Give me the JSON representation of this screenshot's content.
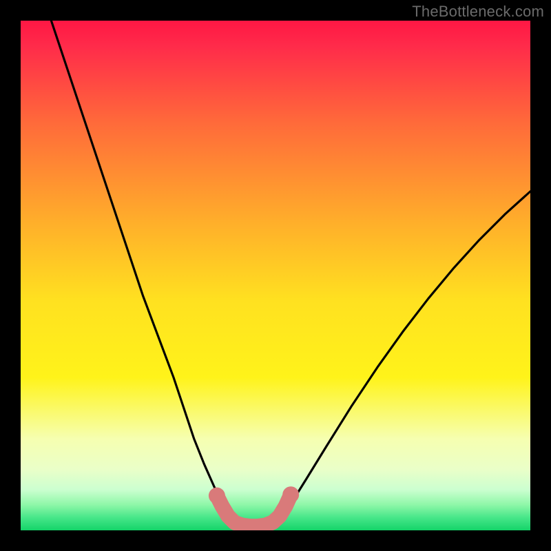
{
  "watermark": "TheBottleneck.com",
  "chart_data": {
    "type": "line",
    "title": "",
    "xlabel": "",
    "ylabel": "",
    "xlim": [
      0,
      1
    ],
    "ylim": [
      0,
      1
    ],
    "gradient_stops": [
      {
        "offset": 0.0,
        "color": "#ff1744"
      },
      {
        "offset": 0.05,
        "color": "#ff2b4a"
      },
      {
        "offset": 0.2,
        "color": "#ff6a3a"
      },
      {
        "offset": 0.4,
        "color": "#ffb02a"
      },
      {
        "offset": 0.55,
        "color": "#ffe120"
      },
      {
        "offset": 0.7,
        "color": "#fff31a"
      },
      {
        "offset": 0.82,
        "color": "#f6ffb0"
      },
      {
        "offset": 0.88,
        "color": "#eaffc8"
      },
      {
        "offset": 0.92,
        "color": "#ccffd0"
      },
      {
        "offset": 0.95,
        "color": "#8ef7a8"
      },
      {
        "offset": 0.975,
        "color": "#47e689"
      },
      {
        "offset": 1.0,
        "color": "#14d469"
      }
    ],
    "series": [
      {
        "name": "bottleneck-curve",
        "color": "#000000",
        "points": [
          [
            0.06,
            1.0
          ],
          [
            0.09,
            0.91
          ],
          [
            0.12,
            0.82
          ],
          [
            0.15,
            0.73
          ],
          [
            0.18,
            0.64
          ],
          [
            0.21,
            0.55
          ],
          [
            0.24,
            0.46
          ],
          [
            0.27,
            0.38
          ],
          [
            0.3,
            0.3
          ],
          [
            0.32,
            0.24
          ],
          [
            0.34,
            0.18
          ],
          [
            0.36,
            0.13
          ],
          [
            0.38,
            0.085
          ],
          [
            0.395,
            0.055
          ],
          [
            0.41,
            0.035
          ],
          [
            0.425,
            0.02
          ],
          [
            0.44,
            0.012
          ],
          [
            0.455,
            0.008
          ],
          [
            0.47,
            0.008
          ],
          [
            0.485,
            0.012
          ],
          [
            0.5,
            0.02
          ],
          [
            0.515,
            0.035
          ],
          [
            0.535,
            0.06
          ],
          [
            0.56,
            0.1
          ],
          [
            0.6,
            0.165
          ],
          [
            0.65,
            0.245
          ],
          [
            0.7,
            0.32
          ],
          [
            0.75,
            0.39
          ],
          [
            0.8,
            0.455
          ],
          [
            0.85,
            0.515
          ],
          [
            0.9,
            0.57
          ],
          [
            0.95,
            0.62
          ],
          [
            1.0,
            0.665
          ]
        ]
      },
      {
        "name": "valley-marker",
        "color": "#d97a7a",
        "points": [
          [
            0.385,
            0.068
          ],
          [
            0.395,
            0.048
          ],
          [
            0.407,
            0.028
          ],
          [
            0.42,
            0.015
          ],
          [
            0.435,
            0.01
          ],
          [
            0.45,
            0.008
          ],
          [
            0.465,
            0.008
          ],
          [
            0.48,
            0.01
          ],
          [
            0.495,
            0.016
          ],
          [
            0.508,
            0.028
          ],
          [
            0.52,
            0.048
          ],
          [
            0.53,
            0.07
          ]
        ]
      }
    ]
  }
}
